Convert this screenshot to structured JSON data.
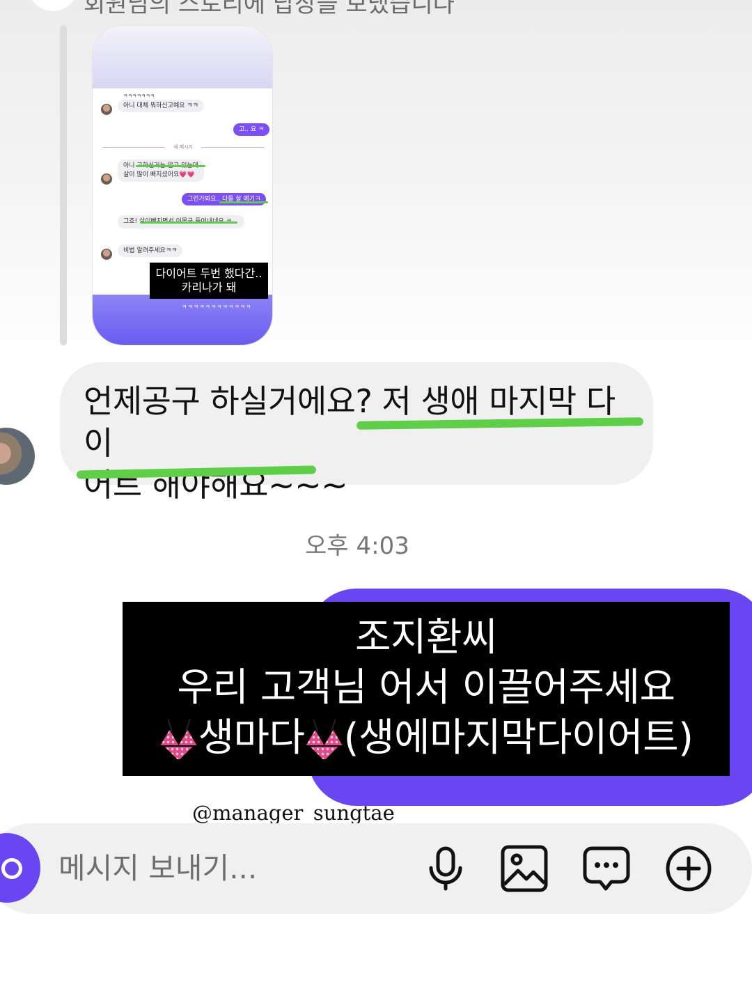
{
  "top": {
    "cut_text": "회원님의 스토리에 답장을 보냈습니다"
  },
  "preview": {
    "msg1_top": "ㅋㅋㅋㅋㅋㅋㅋ",
    "msg1": "아니 대체 뭐하신고예요 ㅋㅋ",
    "out1": "고.. 요 ㅋ",
    "divider": "새 메시지",
    "msg2_line1": "아니 고하신거는 알고 있는데",
    "msg2_line2": "살이 많이 빠지셨어요💗💗",
    "out2": "그런가봐요.. 다들 살 얘기ㅋ",
    "msg3": "그죠! 살이빠지면서 이목구 들어내네요 ㅋ",
    "msg3_line2": "ㅋ",
    "msg4": "비법 알려주세요ㅋㅋ",
    "caption_line1": "다이어트 두번 했다간..",
    "caption_line2": "카리나가 돼",
    "footer": "ㅋㅋㅋㅋㅋㅋㅋㅋㅋㅋㅋㅋ"
  },
  "incoming": {
    "line1": "언제공구 하실거에요? 저 생애 마지막 다이",
    "line2": "어트 해야해요~~~"
  },
  "timestamp": "오후 4:03",
  "outgoing_caption": {
    "line1": "조지환씨",
    "line2": "우리 고객님 어서 이끌어주세요",
    "line3_a": "생마다",
    "line3_b": "(생에마지막다이어트)"
  },
  "mention": "@manager_sungtae",
  "composer": {
    "placeholder": "메시지 보내기..."
  },
  "icons": [
    "camera-icon",
    "microphone-icon",
    "image-icon",
    "chat-bubble-icon",
    "plus-circle-icon",
    "bikini-icon"
  ],
  "colors": {
    "accent": "#6a45f2",
    "highlight": "#5fce48",
    "bubble_in": "#f0f0f1"
  }
}
